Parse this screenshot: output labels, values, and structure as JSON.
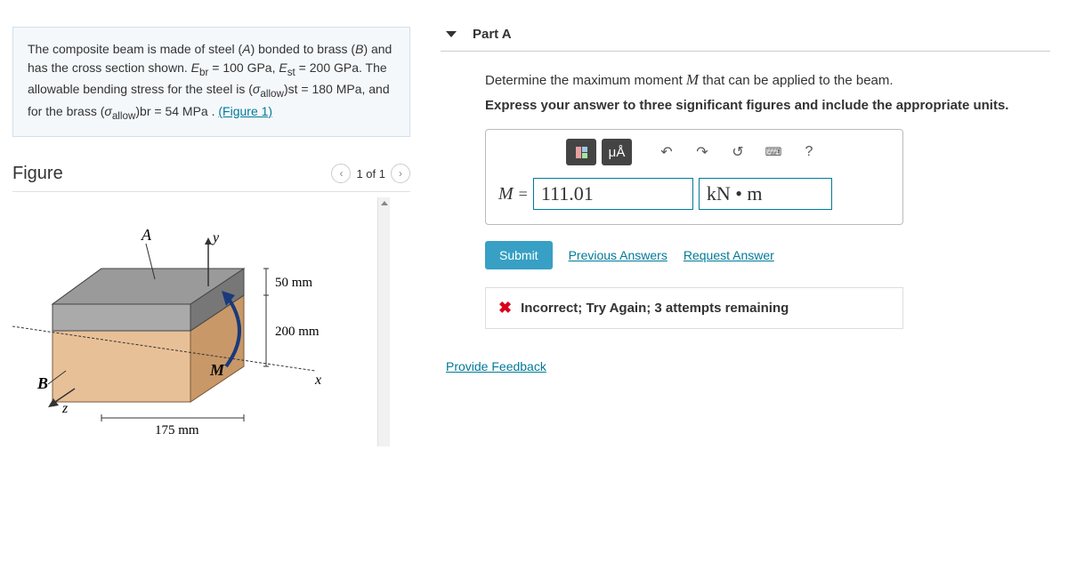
{
  "problem": {
    "text_pre": "The composite beam is made of steel (",
    "matA": "A",
    "text_1": ") bonded to brass (",
    "matB": "B",
    "text_2": ") and has the cross section shown. ",
    "ebr_sym": "E",
    "ebr_sub": "br",
    "ebr_val": " = 100 GPa, ",
    "est_sym": "E",
    "est_sub": "st",
    "est_val": " = 200 GPa. The allowable bending stress for the steel is (",
    "sig1": "σ",
    "allow1": "allow",
    "st1": ")st",
    "sigst_val": " = 180 MPa, and for the brass (",
    "sig2": "σ",
    "allow2": "allow",
    "br1": ")br",
    "sigbr_val": " = 54  MPa . ",
    "fig_link": "(Figure 1)"
  },
  "figure": {
    "title": "Figure",
    "pager": "1 of 1",
    "labelA": "A",
    "labelB": "B",
    "labelM": "M",
    "labely": "y",
    "labelx": "x",
    "labelz": "z",
    "dim50": "50 mm",
    "dim200": "200 mm",
    "dim175": "175 mm"
  },
  "part": {
    "title": "Part A",
    "question_pre": "Determine the maximum moment ",
    "question_var": "M",
    "question_post": " that can be applied to the beam.",
    "instruction": "Express your answer to three significant figures and include the appropriate units.",
    "ua_label": "μÅ",
    "help": "?",
    "eq_var": "M",
    "eq_sign": " = ",
    "value": "111.01",
    "unit": "kN • m",
    "submit": "Submit",
    "prev": "Previous Answers",
    "req": "Request Answer",
    "feedback": "Incorrect; Try Again; 3 attempts remaining",
    "provide": "Provide Feedback"
  }
}
